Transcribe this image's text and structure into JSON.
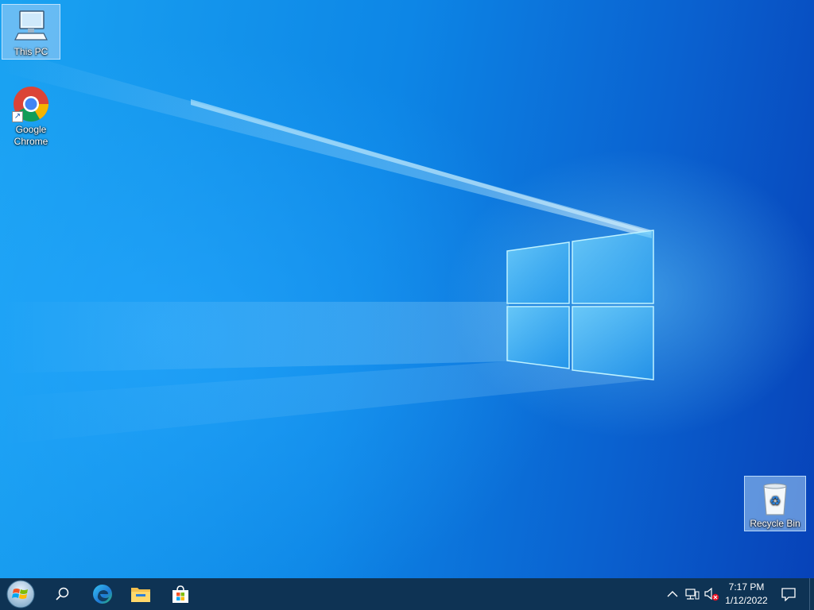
{
  "desktop": {
    "icons": [
      {
        "label": "This PC",
        "icon": "computer-icon",
        "selected": true
      },
      {
        "label": "Google\nChrome",
        "icon": "chrome-icon",
        "shortcut": true
      },
      {
        "label": "Recycle Bin",
        "icon": "recycle-bin-icon",
        "selected": true
      }
    ]
  },
  "taskbar": {
    "start": {
      "icon": "windows-orb-icon"
    },
    "search": {
      "icon": "search-icon"
    },
    "pinned": [
      {
        "name": "Microsoft Edge",
        "icon": "edge-icon"
      },
      {
        "name": "File Explorer",
        "icon": "folder-icon"
      },
      {
        "name": "Microsoft Store",
        "icon": "store-icon"
      }
    ],
    "tray": {
      "icons": [
        "chevron-up-icon",
        "network-icon",
        "volume-muted-icon"
      ],
      "time": "7:17 PM",
      "date": "1/12/2022",
      "notification_icon": "notification-icon"
    }
  },
  "colors": {
    "taskbar_bg": "#0e3354",
    "desktop_light": "#1aa3f2",
    "desktop_dark": "#0742b8"
  }
}
